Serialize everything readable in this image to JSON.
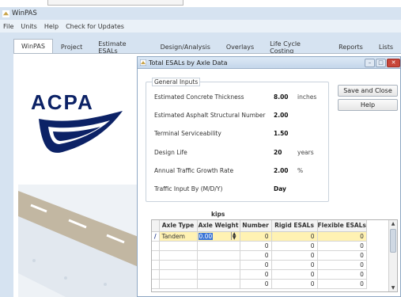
{
  "app": {
    "title": "WinPAS"
  },
  "menu": [
    "File",
    "Units",
    "Help",
    "Check for Updates"
  ],
  "tabs": [
    "WinPAS",
    "Project",
    "Estimate ESALs",
    "Design/Analysis",
    "Overlays",
    "Life Cycle Costing",
    "Reports",
    "Lists"
  ],
  "logo": {
    "text": "ACPA",
    "color": "#0c2266"
  },
  "dialog": {
    "title": "Total ESALs by Axle Data",
    "group_title": "General Inputs",
    "rows": [
      {
        "label": "Estimated Concrete Thickness",
        "value": "8.00",
        "unit": "inches"
      },
      {
        "label": "Estimated Asphalt Structural Number",
        "value": "2.00",
        "unit": ""
      },
      {
        "label": "Terminal Serviceability",
        "value": "1.50",
        "unit": ""
      },
      {
        "label": "Design Life",
        "value": "20",
        "unit": "years"
      },
      {
        "label": "Annual Traffic Growth Rate",
        "value": "2.00",
        "unit": "%"
      },
      {
        "label": "Traffic Input By (M/D/Y)",
        "value": "Day",
        "unit": ""
      }
    ],
    "buttons": {
      "save_close": "Save and Close",
      "help": "Help"
    },
    "kips_label": "kips",
    "grid": {
      "columns": [
        "Axle Type",
        "Axle Weight",
        "Number",
        "Rigid ESALs",
        "Flexible ESALs"
      ],
      "rows": [
        {
          "marker": "/",
          "type": "Tandem",
          "weight": "0.00",
          "number": "0",
          "rigid": "0",
          "flexible": "0"
        },
        {
          "marker": "",
          "type": "",
          "weight": "",
          "number": "0",
          "rigid": "0",
          "flexible": "0"
        },
        {
          "marker": "",
          "type": "",
          "weight": "",
          "number": "0",
          "rigid": "0",
          "flexible": "0"
        },
        {
          "marker": "",
          "type": "",
          "weight": "",
          "number": "0",
          "rigid": "0",
          "flexible": "0"
        },
        {
          "marker": "",
          "type": "",
          "weight": "",
          "number": "0",
          "rigid": "0",
          "flexible": "0"
        },
        {
          "marker": "",
          "type": "",
          "weight": "",
          "number": "0",
          "rigid": "0",
          "flexible": "0"
        }
      ]
    }
  },
  "colors": {
    "accent": "#3a74d6",
    "active_row": "#fff2b3",
    "close_button": "#c8463a",
    "window_bg": "#d6e3f1"
  }
}
